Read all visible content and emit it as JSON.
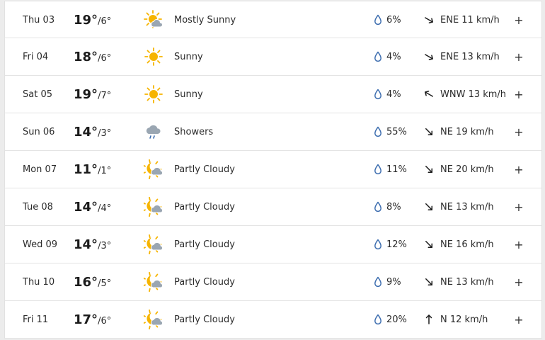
{
  "colors": {
    "sun": "#f6b400",
    "cloud": "#9aa6b2",
    "drop": "#3f6fb0",
    "text": "#1b1b1b"
  },
  "days": [
    {
      "date": "Thu 03",
      "high": "19°",
      "low": "/6°",
      "icon": "mostly-sunny-icon",
      "condition": "Mostly Sunny",
      "precip": "6%",
      "wind_dir_icon": "arrow-ene-icon",
      "wind": "ENE 11 km/h",
      "expand": "+"
    },
    {
      "date": "Fri 04",
      "high": "18°",
      "low": "/6°",
      "icon": "sunny-icon",
      "condition": "Sunny",
      "precip": "4%",
      "wind_dir_icon": "arrow-ene-icon",
      "wind": "ENE 13 km/h",
      "expand": "+"
    },
    {
      "date": "Sat 05",
      "high": "19°",
      "low": "/7°",
      "icon": "sunny-icon",
      "condition": "Sunny",
      "precip": "4%",
      "wind_dir_icon": "arrow-wnw-icon",
      "wind": "WNW 13 km/h",
      "expand": "+"
    },
    {
      "date": "Sun 06",
      "high": "14°",
      "low": "/3°",
      "icon": "showers-icon",
      "condition": "Showers",
      "precip": "55%",
      "wind_dir_icon": "arrow-ne-icon",
      "wind": "NE 19 km/h",
      "expand": "+"
    },
    {
      "date": "Mon 07",
      "high": "11°",
      "low": "/1°",
      "icon": "partly-cloudy-icon",
      "condition": "Partly Cloudy",
      "precip": "11%",
      "wind_dir_icon": "arrow-ne-icon",
      "wind": "NE 20 km/h",
      "expand": "+"
    },
    {
      "date": "Tue 08",
      "high": "14°",
      "low": "/4°",
      "icon": "partly-cloudy-icon",
      "condition": "Partly Cloudy",
      "precip": "8%",
      "wind_dir_icon": "arrow-ne-icon",
      "wind": "NE 13 km/h",
      "expand": "+"
    },
    {
      "date": "Wed 09",
      "high": "14°",
      "low": "/3°",
      "icon": "partly-cloudy-icon",
      "condition": "Partly Cloudy",
      "precip": "12%",
      "wind_dir_icon": "arrow-ne-icon",
      "wind": "NE 16 km/h",
      "expand": "+"
    },
    {
      "date": "Thu 10",
      "high": "16°",
      "low": "/5°",
      "icon": "partly-cloudy-icon",
      "condition": "Partly Cloudy",
      "precip": "9%",
      "wind_dir_icon": "arrow-ne-icon",
      "wind": "NE 13 km/h",
      "expand": "+"
    },
    {
      "date": "Fri 11",
      "high": "17°",
      "low": "/6°",
      "icon": "partly-cloudy-icon",
      "condition": "Partly Cloudy",
      "precip": "20%",
      "wind_dir_icon": "arrow-n-icon",
      "wind": "N 12 km/h",
      "expand": "+"
    }
  ]
}
